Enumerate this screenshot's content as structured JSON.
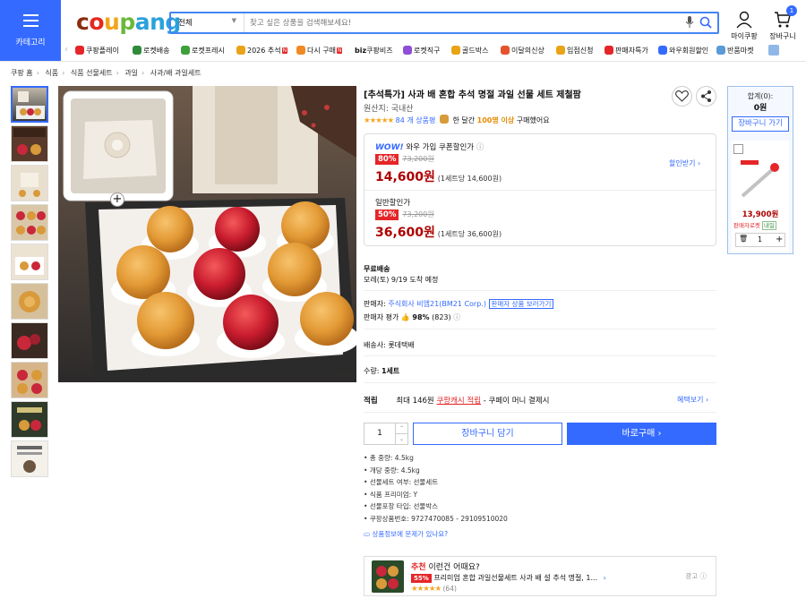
{
  "header": {
    "category_label": "카테고리",
    "search": {
      "scope": "전체",
      "placeholder": "찾고 싶은 상품을 검색해보세요!"
    },
    "mycoupang_label": "마이쿠팡",
    "cart_label": "장바구니",
    "cart_count": "1"
  },
  "nav_items": [
    {
      "label": "쿠팡플레이",
      "color": "#e52528"
    },
    {
      "label": "로켓배송",
      "color": "#2f8a3a"
    },
    {
      "label": "로켓프레시",
      "color": "#3da03a"
    },
    {
      "label": "2026 추석",
      "color": "#e8a317",
      "new": "N"
    },
    {
      "label": "다시 구매",
      "color": "#f08a24",
      "new": "N"
    },
    {
      "label": "쿠팡비즈",
      "prefix": "biz",
      "color": "#1a1a1a"
    },
    {
      "label": "로켓직구",
      "color": "#8e4fd6"
    },
    {
      "label": "골드박스",
      "color": "#e8a317"
    },
    {
      "label": "이달의신상",
      "color": "#e5532d"
    },
    {
      "label": "입점신청",
      "color": "#e8a317"
    },
    {
      "label": "판매자특가",
      "color": "#e52528"
    },
    {
      "label": "와우회원할인",
      "color": "#346aff"
    },
    {
      "label": "반품마켓",
      "color": "#5a9ad6"
    }
  ],
  "breadcrumb": [
    "쿠팡 홈",
    "식품",
    "식품 선물세트",
    "과일",
    "사과/배 과일세트"
  ],
  "product": {
    "title": "[추석특가] 사과 배 혼합 추석 명절 과일 선물 세트 제철팜",
    "origin": "원산지: 국내산",
    "stars": "★★★★★",
    "review_count": "84 개 상품평",
    "bought_prefix": "한 달간",
    "bought_count": "100명 이상",
    "bought_suffix": "구매했어요",
    "wow_label": "WOW!",
    "wow_price_label": "와우 가입 쿠폰할인가",
    "wow_info": "ⓘ",
    "wow_discount": "80%",
    "original_price": "73,200원",
    "wow_price": "14,600원",
    "wow_unit": "(1세트당 14,600원)",
    "coupon_link": "할인받기 ›",
    "normal_price_label": "일반할인가",
    "normal_discount": "50%",
    "normal_original": "73,200원",
    "normal_price": "36,600원",
    "normal_unit": "(1세트당 36,600원)",
    "shipping_title": "무료배송",
    "delivery": "모레(토) 9/19 도착 예정",
    "seller_label": "판매자:",
    "seller": "주식회사 비엠21(BM21 Corp.)",
    "seller_link": "판매자 상품 보러가기",
    "seller_rating_label": "판매자 평가",
    "seller_rating": "98%",
    "seller_rating_count": "(823)",
    "carrier": "배송사: 롯데택배",
    "quantity_label": "수량:",
    "quantity_value": "1세트",
    "points_label": "적립",
    "points_text": "최대 146원",
    "points_link": "쿠팡캐시 적립",
    "points_suffix": "- 쿠페이 머니 결제시",
    "benefits_link": "혜택보기 ›",
    "qty_input": "1",
    "add_cart": "장바구니 담기",
    "buy_now": "바로구매 ›",
    "specs": [
      "총 중량: 4.5kg",
      "개당 중량: 4.5kg",
      "선물세트 여부: 선물세트",
      "식품 프리미엄: Y",
      "선물포장 타입: 선물박스",
      "쿠팡상품번호: 9727470085 - 29109510020"
    ],
    "report_link": "상품정보에 문제가 있나요?"
  },
  "recommend": {
    "title_prefix": "추천",
    "title": "이런건 어때요?",
    "discount": "55%",
    "name": "프리미엄 혼합 과일선물세트 사과 배 설 추석 명절, 1...",
    "stars": "★★★★★",
    "count": "(64)",
    "ad": "광고"
  },
  "side_cart": {
    "sum_label": "합계(0):",
    "sum_value": "0원",
    "go_cart": "장바구니 가기",
    "item_price": "13,900원",
    "item_badge": "판매자로켓",
    "item_badge2": "내일",
    "item_qty": "1"
  }
}
